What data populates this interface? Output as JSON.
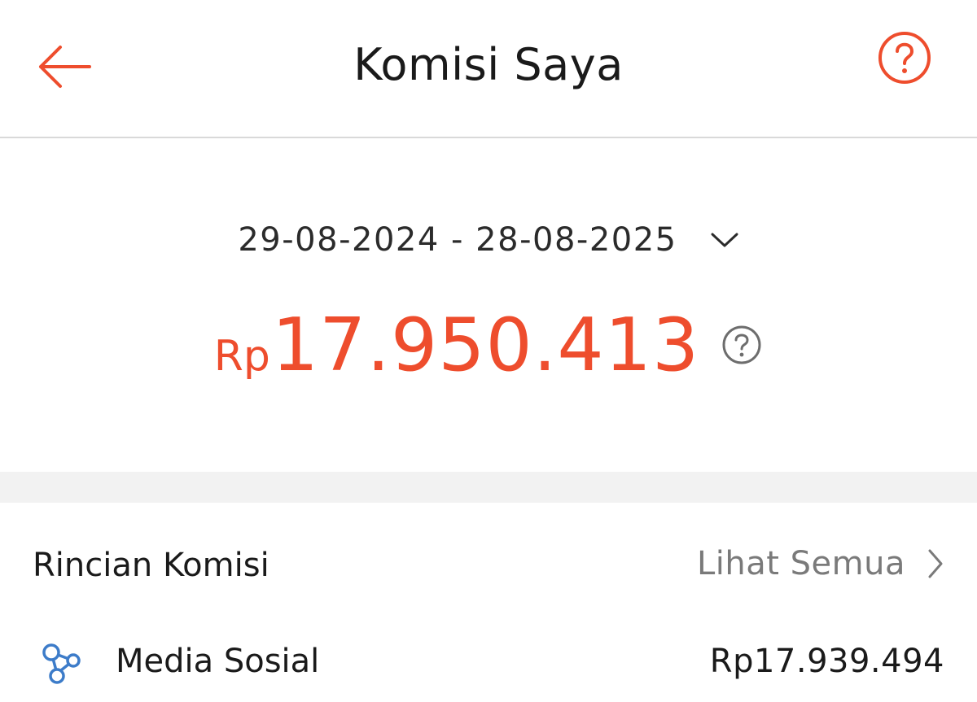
{
  "header": {
    "title": "Komisi Saya",
    "back_icon": "arrow-left-icon",
    "help_icon": "question-circle-icon"
  },
  "summary": {
    "date_range": "29-08-2024 - 28-08-2025",
    "currency": "Rp",
    "amount": "17.950.413",
    "help_icon": "question-circle-icon"
  },
  "details": {
    "title": "Rincian Komisi",
    "see_all_label": "Lihat Semua",
    "rows": [
      {
        "icon": "share-network-icon",
        "label": "Media Sosial",
        "value": "Rp17.939.494"
      }
    ]
  },
  "colors": {
    "accent": "#ee4d2d",
    "icon_blue": "#3d7cc9",
    "text": "#1a1a1a",
    "muted": "#7a7a7a"
  }
}
